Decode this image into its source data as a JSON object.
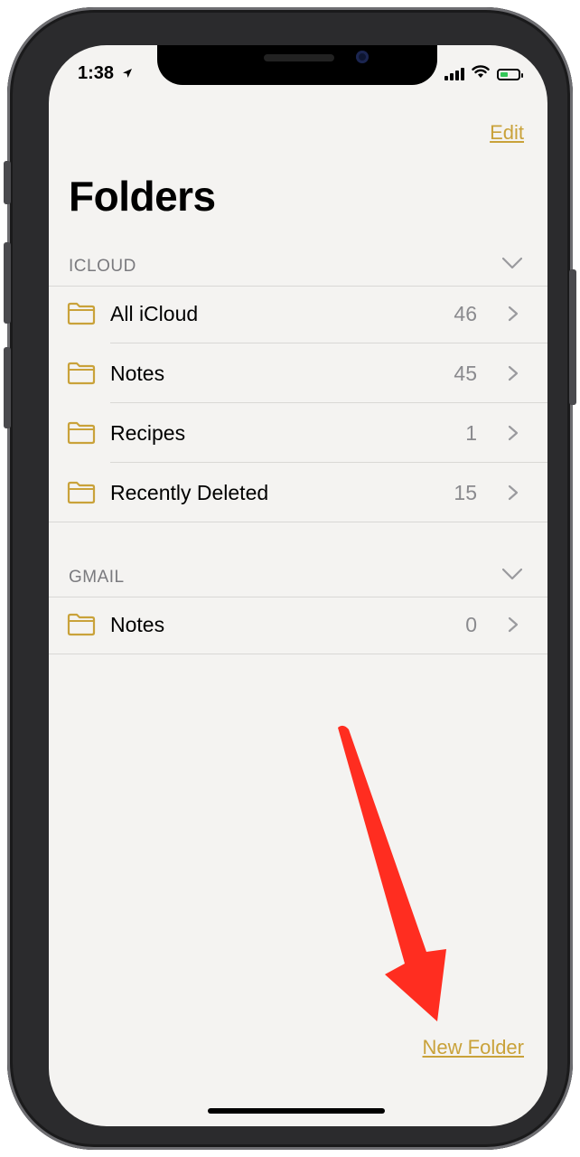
{
  "status_bar": {
    "time": "1:38",
    "location_icon": "location-arrow-icon"
  },
  "navigation": {
    "edit_label": "Edit",
    "title": "Folders"
  },
  "sections": [
    {
      "header": "ICLOUD",
      "folders": [
        {
          "name": "All iCloud",
          "count": "46"
        },
        {
          "name": "Notes",
          "count": "45"
        },
        {
          "name": "Recipes",
          "count": "1"
        },
        {
          "name": "Recently Deleted",
          "count": "15"
        }
      ]
    },
    {
      "header": "GMAIL",
      "folders": [
        {
          "name": "Notes",
          "count": "0"
        }
      ]
    }
  ],
  "toolbar": {
    "new_folder_label": "New Folder"
  },
  "colors": {
    "accent": "#c9a23a",
    "background": "#f4f3f1",
    "annotation_arrow": "#ff2d20",
    "battery_fill": "#34c759"
  }
}
